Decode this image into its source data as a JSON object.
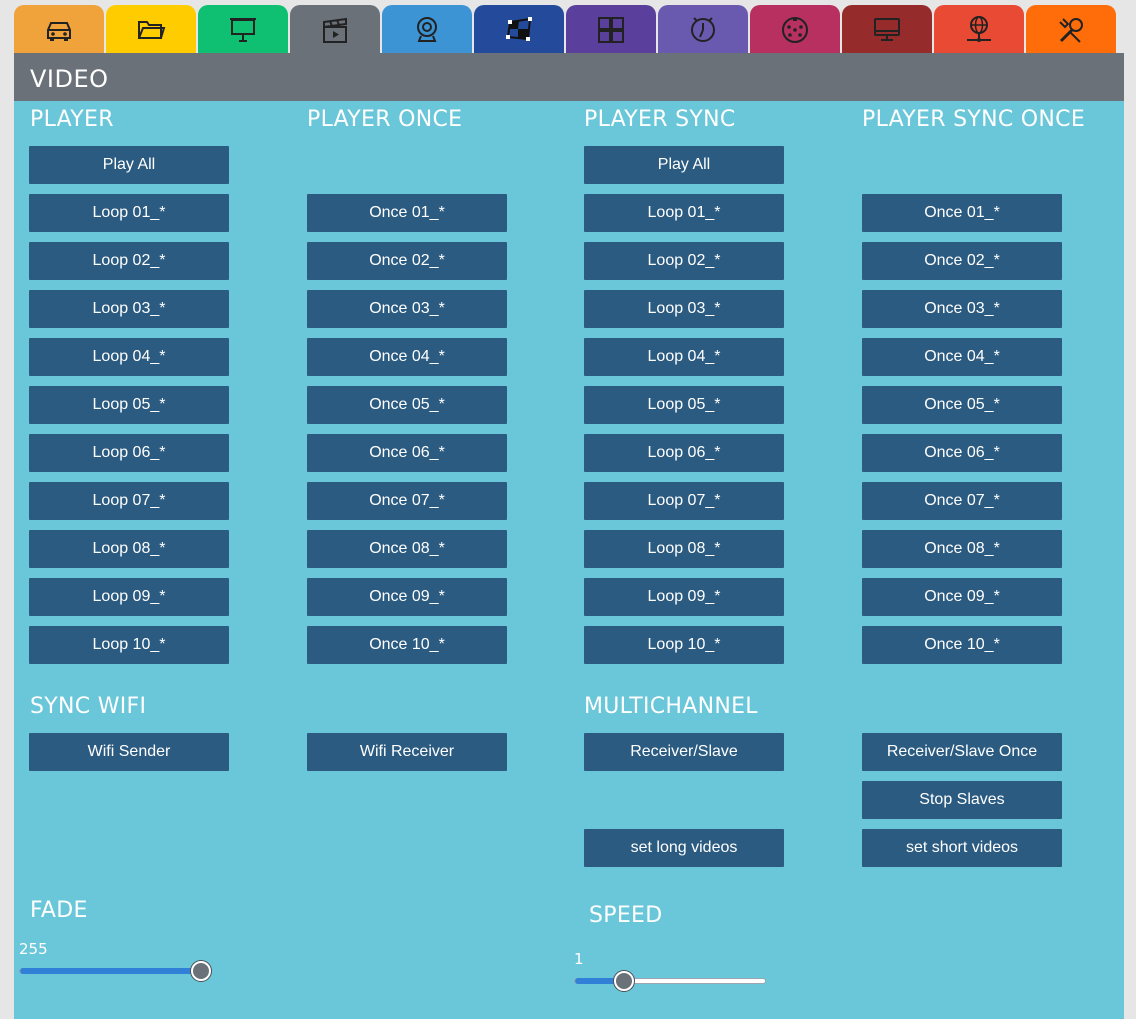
{
  "tabs": [
    {
      "name": "car-icon",
      "color": "#f0a23b"
    },
    {
      "name": "folder-icon",
      "color": "#ffcc00"
    },
    {
      "name": "projector-screen-icon",
      "color": "#0fbf72"
    },
    {
      "name": "clapperboard-icon",
      "color": "#6b7178",
      "active": true
    },
    {
      "name": "webcam-icon",
      "color": "#3d94d4"
    },
    {
      "name": "transform-grid-icon",
      "color": "#244a9c"
    },
    {
      "name": "grid-icon",
      "color": "#5a3f9c"
    },
    {
      "name": "timer-icon",
      "color": "#6a5aaf"
    },
    {
      "name": "dmx-connector-icon",
      "color": "#b8305f"
    },
    {
      "name": "monitor-icon",
      "color": "#962b2b"
    },
    {
      "name": "network-globe-icon",
      "color": "#e84a33"
    },
    {
      "name": "tools-icon",
      "color": "#ff6d0a"
    }
  ],
  "header": {
    "title": "VIDEO"
  },
  "sections": {
    "player": "PLAYER",
    "player_once": "PLAYER ONCE",
    "player_sync": "PLAYER SYNC",
    "player_sync_once": "PLAYER SYNC ONCE",
    "sync_wifi": "SYNC WIFI",
    "multichannel": "MULTICHANNEL",
    "fade": "FADE",
    "speed": "SPEED"
  },
  "player": {
    "play_all": "Play All",
    "loops": [
      "Loop 01_*",
      "Loop 02_*",
      "Loop 03_*",
      "Loop 04_*",
      "Loop 05_*",
      "Loop 06_*",
      "Loop 07_*",
      "Loop 08_*",
      "Loop 09_*",
      "Loop 10_*"
    ]
  },
  "player_once": {
    "onces": [
      "Once 01_*",
      "Once 02_*",
      "Once 03_*",
      "Once 04_*",
      "Once 05_*",
      "Once 06_*",
      "Once 07_*",
      "Once 08_*",
      "Once 09_*",
      "Once 10_*"
    ]
  },
  "player_sync": {
    "play_all": "Play All",
    "loops": [
      "Loop 01_*",
      "Loop 02_*",
      "Loop 03_*",
      "Loop 04_*",
      "Loop 05_*",
      "Loop 06_*",
      "Loop 07_*",
      "Loop 08_*",
      "Loop 09_*",
      "Loop 10_*"
    ]
  },
  "player_sync_once": {
    "onces": [
      "Once 01_*",
      "Once 02_*",
      "Once 03_*",
      "Once 04_*",
      "Once 05_*",
      "Once 06_*",
      "Once 07_*",
      "Once 08_*",
      "Once 09_*",
      "Once 10_*"
    ]
  },
  "sync_wifi": {
    "sender": "Wifi Sender",
    "receiver": "Wifi Receiver"
  },
  "multichannel": {
    "receiver_slave": "Receiver/Slave",
    "receiver_slave_once": "Receiver/Slave Once",
    "stop_slaves": "Stop Slaves",
    "set_long": "set long videos",
    "set_short": "set short videos"
  },
  "fade": {
    "value": "255",
    "fraction": 1.0
  },
  "speed": {
    "value": "1",
    "fraction": 0.26
  },
  "colors": {
    "panel": "#6ac6d9",
    "header": "#6b7178",
    "button": "#2b5b80",
    "slider_fill": "#3080d8"
  }
}
